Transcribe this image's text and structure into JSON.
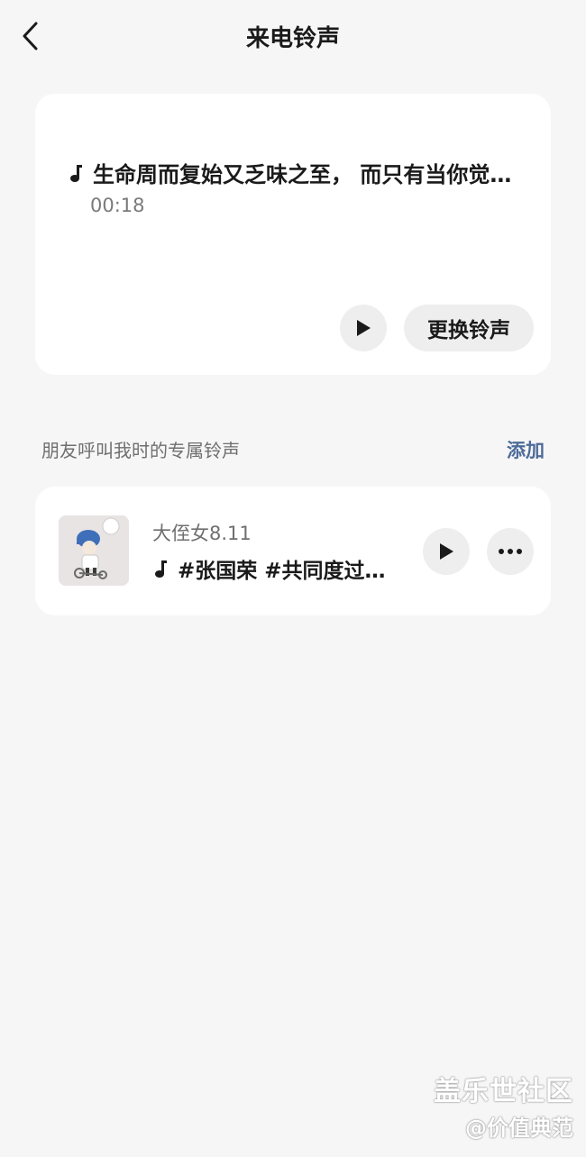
{
  "header": {
    "title": "来电铃声",
    "back_icon": "chevron-left-icon"
  },
  "current_ringtone": {
    "note_icon": "music-note-icon",
    "title": "生命周而复始又乏味之至， 而只有当你觉…",
    "duration": "00:18",
    "play_icon": "play-icon",
    "change_label": "更换铃声"
  },
  "friends_section": {
    "label": "朋友呼叫我时的专属铃声",
    "add_label": "添加",
    "accent_color": "#4d6b9a",
    "items": [
      {
        "name": "大侄女8.11",
        "song": "#张国荣 #共同度过…",
        "note_icon": "music-note-icon",
        "play_icon": "play-icon",
        "more_icon": "more-horizontal-icon"
      }
    ]
  },
  "watermark": {
    "line1": "盖乐世社区",
    "line2": "@价值典范"
  }
}
